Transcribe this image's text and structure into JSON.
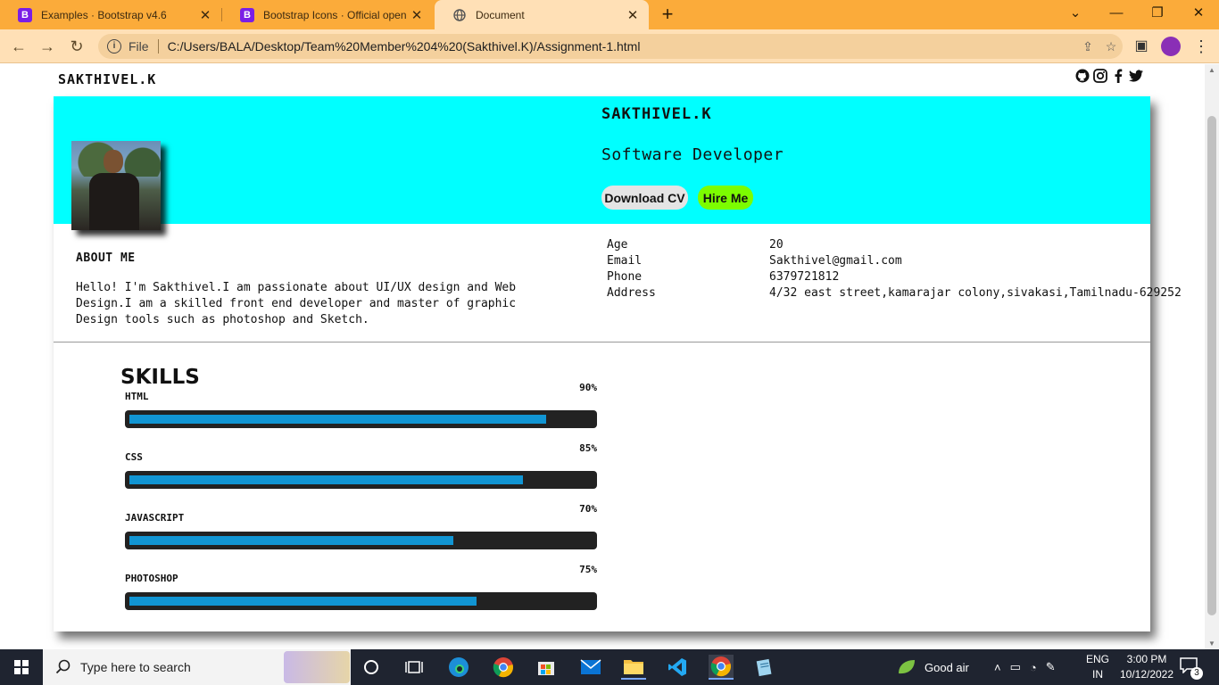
{
  "browser": {
    "tabs": [
      {
        "label": "Examples · Bootstrap v4.6",
        "favicon": "B"
      },
      {
        "label": "Bootstrap Icons · Official open so",
        "favicon": "B"
      },
      {
        "label": "Document",
        "favicon": "globe"
      }
    ],
    "address": {
      "scheme_label": "File",
      "url": "C:/Users/BALA/Desktop/Team%20Member%204%20(Sakthivel.K)/Assignment-1.html"
    }
  },
  "page": {
    "brand": "SAKTHIVEL.K",
    "social_icons": [
      "github-icon",
      "instagram-icon",
      "facebook-icon",
      "twitter-icon"
    ],
    "hero": {
      "name": "SAKTHIVEL.K",
      "role": "Software Developer",
      "download_cv": "Download CV",
      "hire_me": "Hire Me",
      "bg_color": "#00ffff",
      "hire_color": "#7cfc00"
    },
    "about": {
      "title": "ABOUT ME",
      "text": "Hello! I'm Sakthivel.I am passionate about UI/UX design and Web Design.I am a skilled front end developer and master of graphic Design tools such as photoshop and Sketch."
    },
    "info": [
      {
        "key": "Age",
        "value": "20"
      },
      {
        "key": "Email",
        "value": "Sakthivel@gmail.com"
      },
      {
        "key": "Phone",
        "value": "6379721812"
      },
      {
        "key": "Address",
        "value": "4/32 east street,kamarajar colony,sivakasi,Tamilnadu-629252"
      }
    ],
    "skills_title": "SKILLS",
    "skills": [
      {
        "name": "HTML",
        "percent_label": "90%",
        "percent": 90
      },
      {
        "name": "CSS",
        "percent_label": "85%",
        "percent": 85
      },
      {
        "name": "JAVASCRIPT",
        "percent_label": "70%",
        "percent": 70
      },
      {
        "name": "PHOTOSHOP",
        "percent_label": "75%",
        "percent": 75
      }
    ],
    "bar_color": "#1195d3"
  },
  "taskbar": {
    "search_placeholder": "Type here to search",
    "weather": "Good air",
    "lang_top": "ENG",
    "lang_bottom": "IN",
    "time": "3:00 PM",
    "date": "10/12/2022",
    "notification_count": "3"
  }
}
